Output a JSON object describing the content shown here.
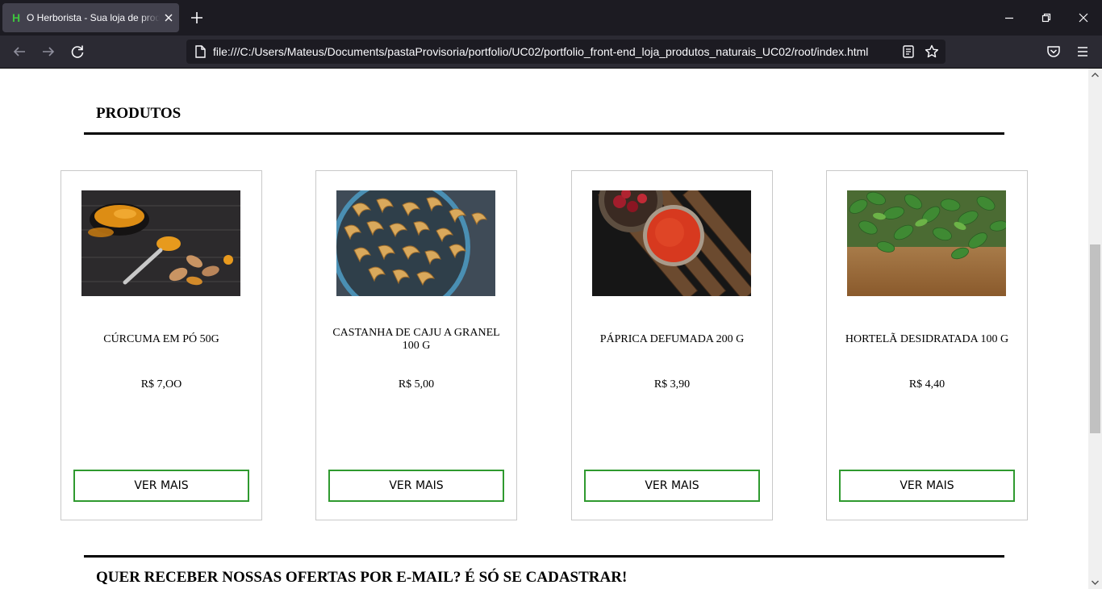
{
  "browser": {
    "tab_title": "O Herborista - Sua loja de produtos naturais",
    "favicon_glyph": "H",
    "url": "file:///C:/Users/Mateus/Documents/pastaProvisoria/portfolio/UC02/portfolio_front-end_loja_produtos_naturais_UC02/root/index.html",
    "colors": {
      "tabbar": "#1c1b22",
      "tab_active": "#42414d",
      "navbar": "#2b2a33",
      "favicon": "#3ec43e"
    }
  },
  "page": {
    "section_title": "PRODUTOS",
    "products": [
      {
        "name": "CÚRCUMA EM PÓ 50G",
        "price": "R$ 7,OO",
        "button": "VER MAIS",
        "image": "turmeric-powder-photo"
      },
      {
        "name": "CASTANHA DE CAJU A GRANEL 100 G",
        "price": "R$ 5,00",
        "button": "VER MAIS",
        "image": "cashew-nuts-photo"
      },
      {
        "name": "PÁPRICA DEFUMADA 200 G",
        "price": "R$ 3,90",
        "button": "VER MAIS",
        "image": "smoked-paprika-photo"
      },
      {
        "name": "HORTELÃ DESIDRATADA 100 G",
        "price": "R$ 4,40",
        "button": "VER MAIS",
        "image": "mint-leaves-photo"
      }
    ],
    "newsletter_title": "QUER RECEBER NOSSAS OFERTAS POR E-MAIL? É SÓ SE CADASTRAR!",
    "colors": {
      "button_border": "#2f9a2f",
      "card_border": "#c9c9c9",
      "rule": "#000000"
    }
  }
}
